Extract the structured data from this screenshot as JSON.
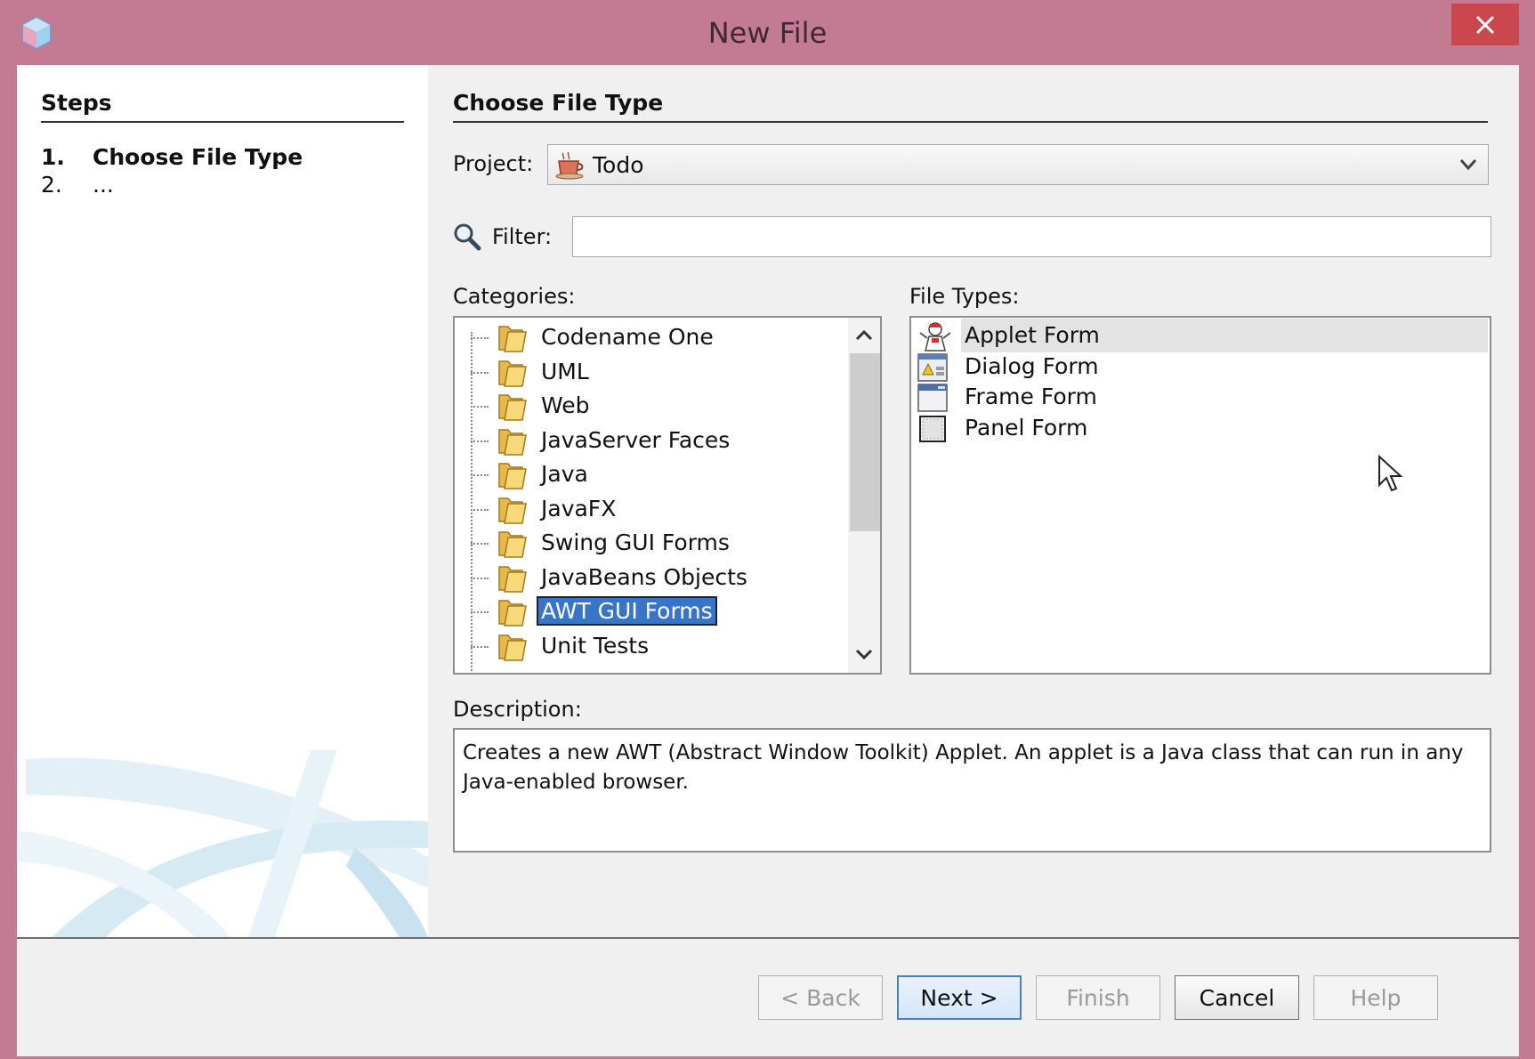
{
  "window": {
    "title": "New File"
  },
  "steps": {
    "heading": "Steps",
    "items": [
      {
        "num": "1.",
        "label": "Choose File Type"
      },
      {
        "num": "2.",
        "label": "..."
      }
    ]
  },
  "main": {
    "heading": "Choose File Type",
    "project_label": "Project:",
    "project_value": "Todo",
    "filter_label": "Filter:",
    "filter_value": "",
    "categories_label": "Categories:",
    "categories": [
      "Codename One",
      "UML",
      "Web",
      "JavaServer Faces",
      "Java",
      "JavaFX",
      "Swing GUI Forms",
      "JavaBeans Objects",
      "AWT GUI Forms",
      "Unit Tests"
    ],
    "selected_category": "AWT GUI Forms",
    "file_types_label": "File Types:",
    "file_types": [
      {
        "label": "Applet Form",
        "icon": "applet-icon"
      },
      {
        "label": "Dialog Form",
        "icon": "dialog-icon"
      },
      {
        "label": "Frame Form",
        "icon": "frame-icon"
      },
      {
        "label": "Panel Form",
        "icon": "panel-icon"
      }
    ],
    "selected_file_type": "Applet Form",
    "description_label": "Description:",
    "description": "Creates a new AWT (Abstract Window Toolkit) Applet. An applet is a Java class that can run in any Java-enabled browser."
  },
  "buttons": {
    "back": "< Back",
    "next": "Next >",
    "finish": "Finish",
    "cancel": "Cancel",
    "help": "Help"
  },
  "colors": {
    "titlebar": "#c37b93",
    "close": "#c9474d",
    "selection": "#3874c8"
  }
}
